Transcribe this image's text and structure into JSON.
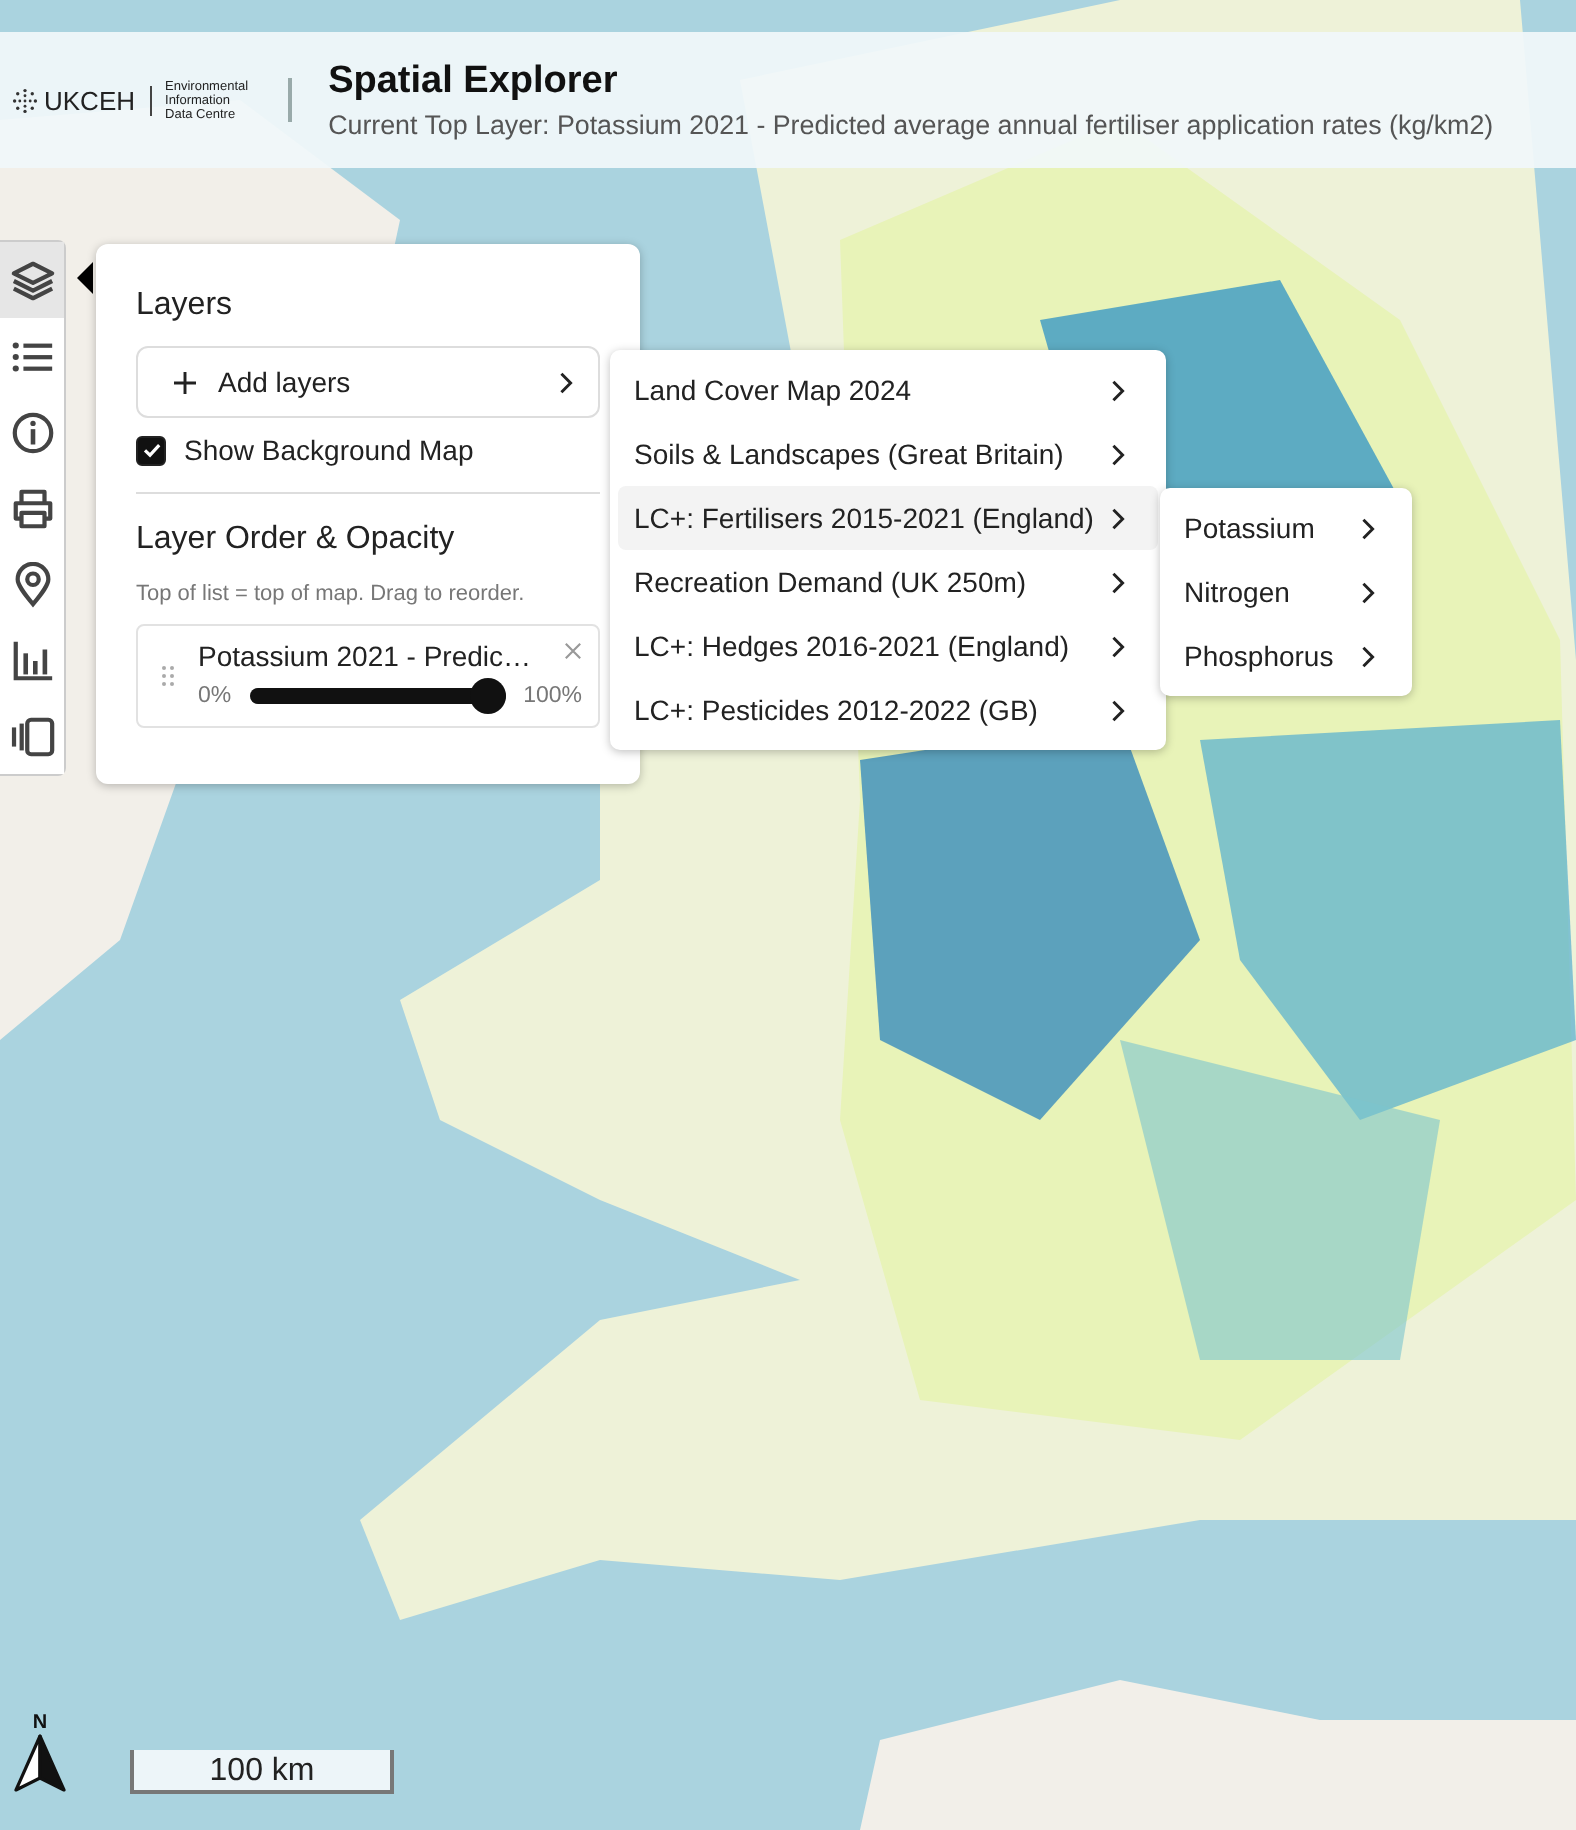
{
  "header": {
    "logo_name": "UKCEH",
    "logo_subtitle": [
      "Environmental",
      "Information",
      "Data Centre"
    ],
    "title": "Spatial Explorer",
    "subtitle": "Current Top Layer: Potassium 2021 - Predicted average annual fertiliser application rates (kg/km2)"
  },
  "toolbar": [
    {
      "kind": "layers",
      "selected": true
    },
    {
      "kind": "list",
      "selected": false
    },
    {
      "kind": "info",
      "selected": false
    },
    {
      "kind": "print",
      "selected": false
    },
    {
      "kind": "pin",
      "selected": false
    },
    {
      "kind": "chart",
      "selected": false
    },
    {
      "kind": "carousel",
      "selected": false
    }
  ],
  "layers_panel": {
    "title": "Layers",
    "add_button": "Add layers",
    "show_background": {
      "label": "Show Background Map",
      "checked": true
    },
    "order_title": "Layer Order & Opacity",
    "hint": "Top of list = top of map. Drag to reorder.",
    "layers": [
      {
        "name": "Potassium 2021 - Predic…",
        "min_label": "0%",
        "max_label": "100%",
        "level": 1
      }
    ]
  },
  "menu": {
    "items": [
      {
        "label": "Land Cover Map 2024",
        "selected": false
      },
      {
        "label": "Soils & Landscapes (Great Britain)",
        "selected": false
      },
      {
        "label": "LC+: Fertilisers 2015-2021 (England)",
        "selected": true
      },
      {
        "label": "Recreation Demand (UK 250m)",
        "selected": false
      },
      {
        "label": "LC+: Hedges 2016-2021 (England)",
        "selected": false
      },
      {
        "label": "LC+: Pesticides 2012-2022 (GB)",
        "selected": false
      }
    ]
  },
  "submenu": {
    "items": [
      {
        "label": "Potassium",
        "selected": false
      },
      {
        "label": "Nitrogen",
        "selected": false
      },
      {
        "label": "Phosphorus",
        "selected": false
      }
    ]
  },
  "scale_bar": {
    "label": "100 km"
  },
  "north_arrow": {
    "label": "N"
  }
}
